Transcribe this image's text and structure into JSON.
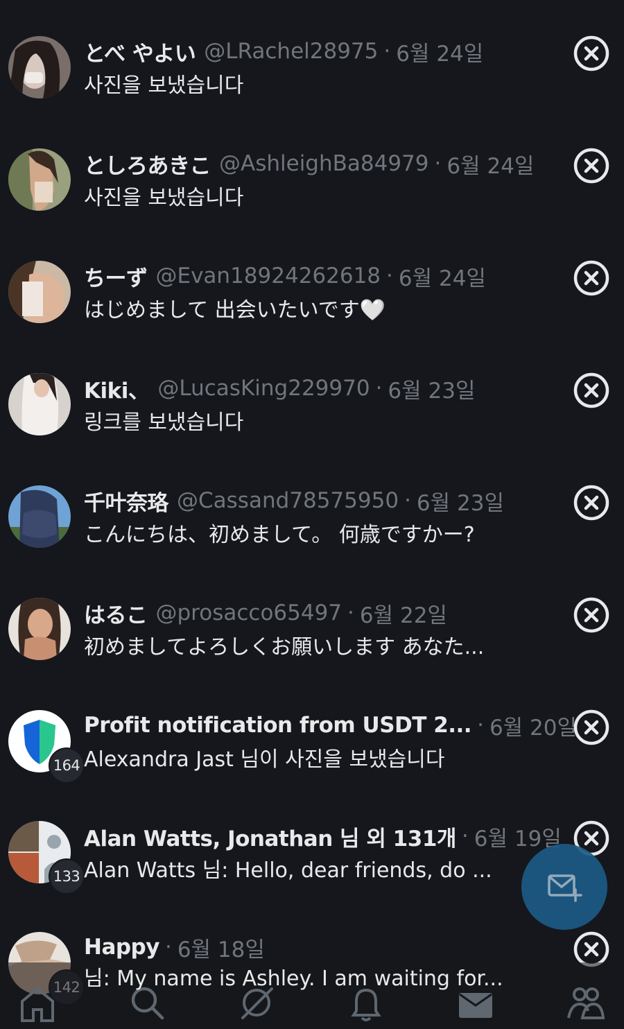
{
  "conversations": [
    {
      "name": "とべ やよい",
      "handle": "@LRachel28975",
      "date": "6월 24일",
      "preview": "사진을 보냈습니다",
      "badge": ""
    },
    {
      "name": "としろあきこ",
      "handle": "@AshleighBa84979",
      "date": "6월 24일",
      "preview": "사진을 보냈습니다",
      "badge": ""
    },
    {
      "name": "ちーず",
      "handle": "@Evan18924262618",
      "date": "6월 24일",
      "preview": "はじめまして 出会いたいです🤍",
      "badge": ""
    },
    {
      "name": "Kiki、",
      "handle": "@LucasKing229970",
      "date": "6월 23일",
      "preview": "링크를 보냈습니다",
      "badge": ""
    },
    {
      "name": "千叶奈珞",
      "handle": "@Cassand78575950",
      "date": "6월 23일",
      "preview": "こんにちは、初めまして。 何歳ですかー?",
      "badge": ""
    },
    {
      "name": "はるこ",
      "handle": "@prosacco65497",
      "date": "6월 22일",
      "preview": "初めましてよろしくお願いします あなた...",
      "badge": ""
    },
    {
      "name": "Profit notification from USDT 2...",
      "handle": "",
      "date": "6월 20일",
      "preview": "Alexandra Jast 님이 사진을 보냈습니다",
      "badge": "164"
    },
    {
      "name": "Alan Watts, Jonathan 님 외 131개",
      "handle": "",
      "date": "6월 19일",
      "preview": "Alan Watts 님: Hello, dear friends, do ...",
      "badge": "133"
    },
    {
      "name": "Happy",
      "handle": "",
      "date": "6월 18일",
      "preview": "님: My name is Ashley. I am waiting for...",
      "badge": "142"
    }
  ],
  "separator": "·",
  "icons": {
    "close": "close-circle-icon",
    "compose": "new-message-icon",
    "nav": [
      "home-icon",
      "search-icon",
      "grok-icon",
      "notifications-icon",
      "messages-icon",
      "communities-icon"
    ]
  },
  "colors": {
    "background": "#15171c",
    "muted": "#71767b",
    "text": "#e7e9ea",
    "fab": "#1c5b86"
  }
}
